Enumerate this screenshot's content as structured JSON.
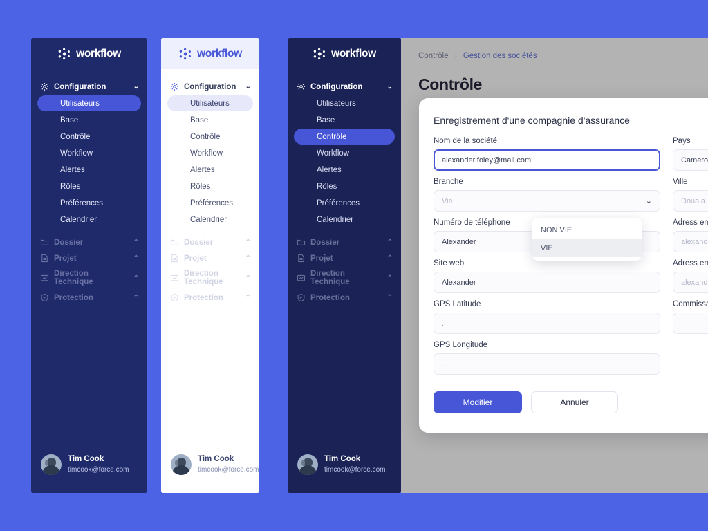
{
  "theme": {
    "page_bg": "#4c63e6",
    "accent": "#4656d6",
    "sidebar_dark_bg": "#1f2a6b",
    "sidebar_darkest_bg": "#1a2256",
    "sidebar_light_bg": "#ffffff",
    "main_bg": "#b3b3b3"
  },
  "brand": {
    "name": "workflow",
    "mark": "workflow-dots-logo"
  },
  "sidebar": {
    "section": {
      "label": "Configuration",
      "icon": "gear-icon",
      "chevron": "chevron-down-icon"
    },
    "items": [
      {
        "label": "Utilisateurs"
      },
      {
        "label": "Base"
      },
      {
        "label": "Contrôle"
      },
      {
        "label": "Workflow"
      },
      {
        "label": "Alertes"
      },
      {
        "label": "Rôles"
      },
      {
        "label": "Préférences"
      },
      {
        "label": "Calendrier"
      }
    ],
    "collapsed_sections": [
      {
        "label": "Dossier",
        "icon": "folder-icon",
        "chevron": "chevron-up-icon"
      },
      {
        "label": "Projet",
        "icon": "document-icon",
        "chevron": "chevron-up-icon"
      },
      {
        "label": "Direction Technique",
        "icon": "monitor-icon",
        "chevron": "chevron-up-icon"
      },
      {
        "label": "Protection",
        "icon": "shield-icon",
        "chevron": "chevron-up-icon"
      }
    ],
    "active_item_variant_1": "Utilisateurs",
    "active_item_variant_2": "Utilisateurs",
    "active_item_variant_3": "Contrôle",
    "profile": {
      "name": "Tim Cook",
      "email": "timcook@force.com",
      "avatar": "user-avatar"
    }
  },
  "main": {
    "breadcrumb": {
      "parent": "Contrôle",
      "separator": "›",
      "current": "Gestion des sociétés"
    },
    "page_title": "Contrôle"
  },
  "modal": {
    "title": "Enregistrement d'une compagnie d'assurance",
    "fields_left": [
      {
        "label": "Nom de la société",
        "value": "alexander.foley@mail.com",
        "placeholder": "",
        "state": "focused",
        "type": "text"
      },
      {
        "label": "Branche",
        "value": "",
        "placeholder": "Vie",
        "state": "open",
        "type": "select"
      },
      {
        "label": "Numéro de téléphone",
        "value": "Alexander",
        "placeholder": "",
        "state": "default",
        "type": "text"
      },
      {
        "label": "Site web",
        "value": "Alexander",
        "placeholder": "",
        "state": "default",
        "type": "text"
      },
      {
        "label": "GPS Latitude",
        "value": ".",
        "placeholder": "",
        "state": "default",
        "type": "text"
      },
      {
        "label": "GPS Longitude",
        "value": ".",
        "placeholder": "",
        "state": "default",
        "type": "text"
      }
    ],
    "fields_right": [
      {
        "label": "Pays",
        "value": "Cameroun",
        "placeholder": "",
        "state": "default",
        "type": "text"
      },
      {
        "label": "Ville",
        "value": "",
        "placeholder": "Douala",
        "state": "placeholder",
        "type": "text"
      },
      {
        "label": "Adress email",
        "value": "",
        "placeholder": "alexander.fo",
        "state": "placeholder",
        "type": "text"
      },
      {
        "label": "Adress email",
        "value": "",
        "placeholder": "alexander@",
        "state": "placeholder",
        "type": "text"
      },
      {
        "label": "Commissaire",
        "value": ".",
        "placeholder": "",
        "state": "default",
        "type": "text"
      }
    ],
    "dropdown": {
      "options": [
        {
          "label": "NON VIE",
          "highlighted": false
        },
        {
          "label": "VIE",
          "highlighted": true
        }
      ]
    },
    "buttons": {
      "submit": "Modifier",
      "cancel": "Annuler"
    }
  }
}
